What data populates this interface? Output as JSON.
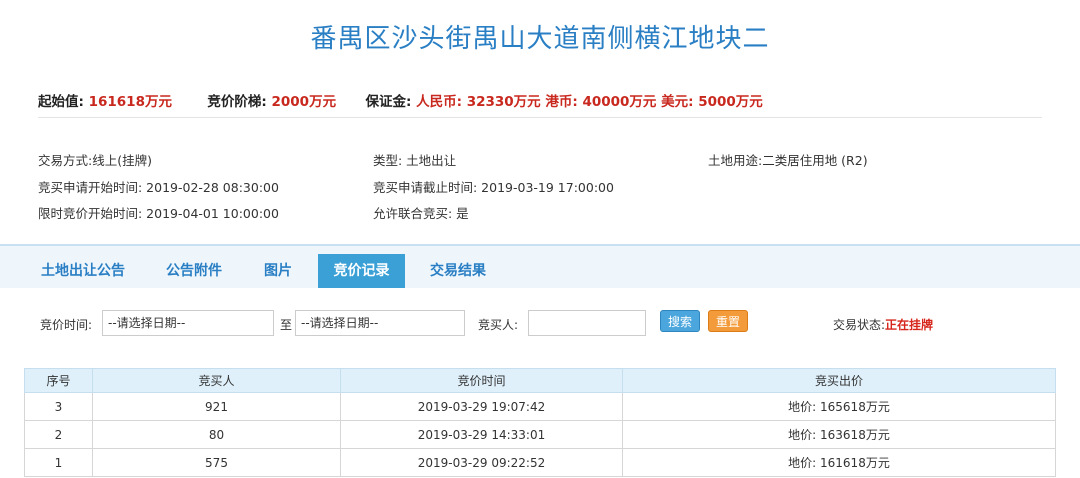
{
  "title": "番禺区沙头街禺山大道南侧横江地块二",
  "price": {
    "start_label": "起始值:",
    "start_value": "161618万元",
    "step_label": "竞价阶梯:",
    "step_value": "2000万元",
    "deposit_label": "保证金:",
    "deposit_value": "人民币: 32330万元 港币: 40000万元 美元: 5000万元"
  },
  "info": {
    "trade_method": "交易方式:线上(挂牌)",
    "type": "类型: 土地出让",
    "land_use": "土地用途:二类居住用地 (R2)",
    "apply_start": "竞买申请开始时间:   2019-02-28 08:30:00",
    "apply_end": "竞买申请截止时间: 2019-03-19 17:00:00",
    "bid_start": "限时竞价开始时间: 2019-04-01 10:00:00",
    "joint_bid": "允许联合竞买: 是"
  },
  "tabs": [
    "土地出让公告",
    "公告附件",
    "图片",
    "竞价记录",
    "交易结果"
  ],
  "filter": {
    "time_label": "竞价时间:",
    "date_from": "--请选择日期--",
    "to_label": "至",
    "date_to": "--请选择日期--",
    "buyer_label": "竞买人:",
    "buyer_value": "",
    "search_button": "搜索",
    "reset_button": "重置",
    "status_label": "交易状态:",
    "status_value": "正在挂牌"
  },
  "table": {
    "headers": [
      "序号",
      "竞买人",
      "竞价时间",
      "竞买出价"
    ],
    "rows": [
      [
        "3",
        "921",
        "2019-03-29 19:07:42",
        "地价: 165618万元"
      ],
      [
        "2",
        "80",
        "2019-03-29 14:33:01",
        "地价: 163618万元"
      ],
      [
        "1",
        "575",
        "2019-03-29 09:22:52",
        "地价: 161618万元"
      ]
    ]
  },
  "colors": {
    "accent_blue": "#2a7fc4",
    "price_red": "#c8281e",
    "active_tab": "#3aa0d6",
    "search_button": "#4aa6dc",
    "reset_button": "#f39b3a"
  }
}
